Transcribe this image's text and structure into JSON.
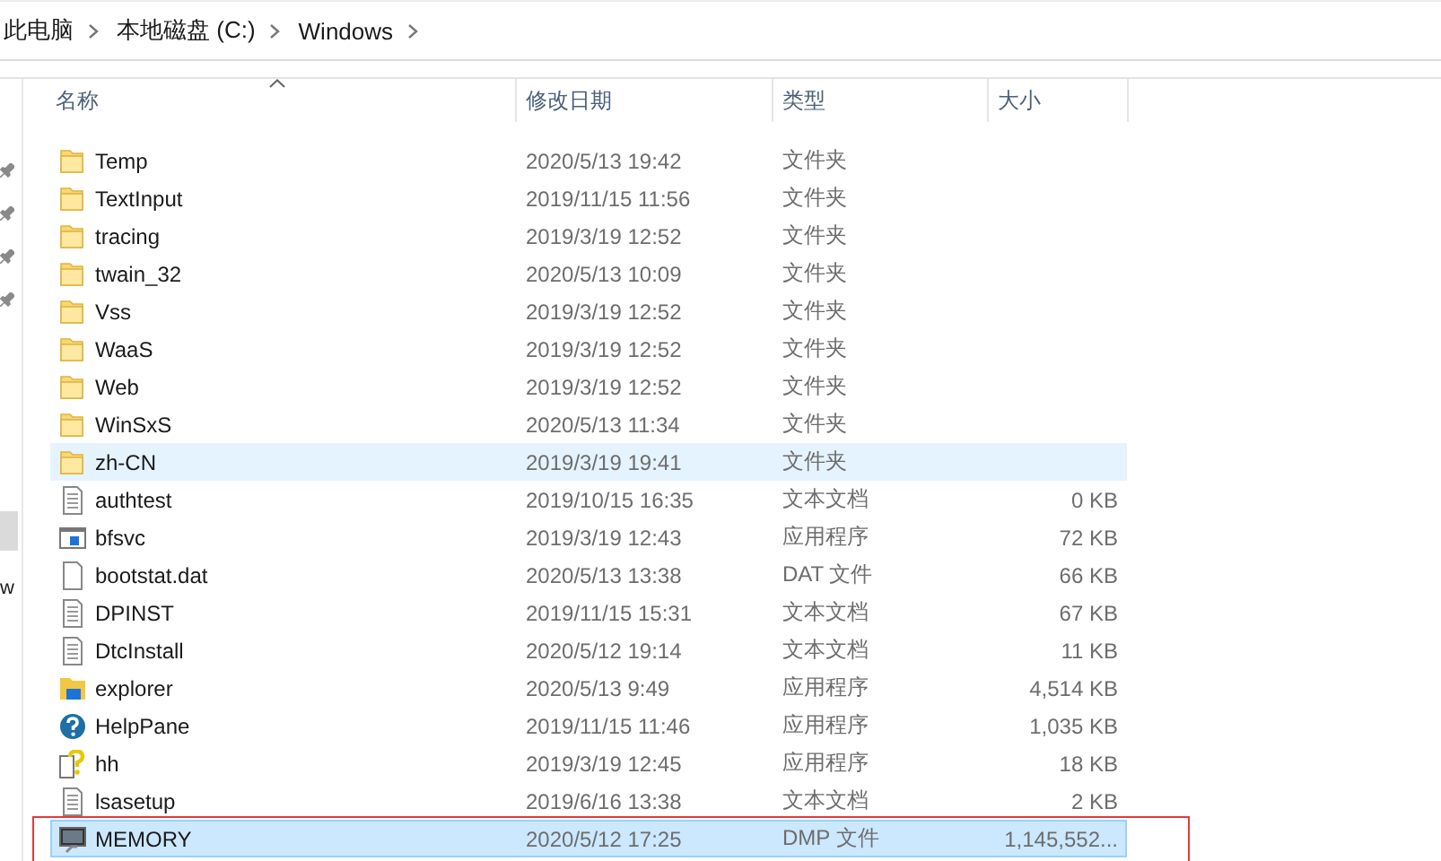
{
  "breadcrumb": [
    "此电脑",
    "本地磁盘 (C:)",
    "Windows"
  ],
  "nav_pane": {
    "items": [
      {
        "kind": "pin"
      },
      {
        "kind": "pin"
      },
      {
        "kind": "pin"
      },
      {
        "kind": "pin"
      },
      {
        "kind": "gap"
      },
      {
        "kind": "selected"
      },
      {
        "kind": "text",
        "label": "w"
      }
    ]
  },
  "table": {
    "columns": [
      {
        "label": "名称",
        "sorted": true
      },
      {
        "label": "修改日期",
        "sorted": false
      },
      {
        "label": "类型",
        "sorted": false
      },
      {
        "label": "大小",
        "sorted": false
      }
    ],
    "rows": [
      {
        "kind": "folder",
        "name": "Temp",
        "date": "2020/5/13 19:42",
        "type": "文件夹",
        "size": "",
        "highlighted": false,
        "selected": false
      },
      {
        "kind": "folder",
        "name": "TextInput",
        "date": "2019/11/15 11:56",
        "type": "文件夹",
        "size": "",
        "highlighted": false,
        "selected": false
      },
      {
        "kind": "folder",
        "name": "tracing",
        "date": "2019/3/19 12:52",
        "type": "文件夹",
        "size": "",
        "highlighted": false,
        "selected": false
      },
      {
        "kind": "folder",
        "name": "twain_32",
        "date": "2020/5/13 10:09",
        "type": "文件夹",
        "size": "",
        "highlighted": false,
        "selected": false
      },
      {
        "kind": "folder",
        "name": "Vss",
        "date": "2019/3/19 12:52",
        "type": "文件夹",
        "size": "",
        "highlighted": false,
        "selected": false
      },
      {
        "kind": "folder",
        "name": "WaaS",
        "date": "2019/3/19 12:52",
        "type": "文件夹",
        "size": "",
        "highlighted": false,
        "selected": false
      },
      {
        "kind": "folder",
        "name": "Web",
        "date": "2019/3/19 12:52",
        "type": "文件夹",
        "size": "",
        "highlighted": false,
        "selected": false
      },
      {
        "kind": "folder",
        "name": "WinSxS",
        "date": "2020/5/13 11:34",
        "type": "文件夹",
        "size": "",
        "highlighted": false,
        "selected": false
      },
      {
        "kind": "folder",
        "name": "zh-CN",
        "date": "2019/3/19 19:41",
        "type": "文件夹",
        "size": "",
        "highlighted": true,
        "selected": false
      },
      {
        "kind": "text",
        "name": "authtest",
        "date": "2019/10/15 16:35",
        "type": "文本文档",
        "size": "0 KB",
        "highlighted": false,
        "selected": false
      },
      {
        "kind": "app",
        "name": "bfsvc",
        "date": "2019/3/19 12:43",
        "type": "应用程序",
        "size": "72 KB",
        "highlighted": false,
        "selected": false
      },
      {
        "kind": "blank",
        "name": "bootstat.dat",
        "date": "2020/5/13 13:38",
        "type": "DAT 文件",
        "size": "66 KB",
        "highlighted": false,
        "selected": false
      },
      {
        "kind": "text",
        "name": "DPINST",
        "date": "2019/11/15 15:31",
        "type": "文本文档",
        "size": "67 KB",
        "highlighted": false,
        "selected": false
      },
      {
        "kind": "text",
        "name": "DtcInstall",
        "date": "2020/5/12 19:14",
        "type": "文本文档",
        "size": "11 KB",
        "highlighted": false,
        "selected": false
      },
      {
        "kind": "explorer",
        "name": "explorer",
        "date": "2020/5/13 9:49",
        "type": "应用程序",
        "size": "4,514 KB",
        "highlighted": false,
        "selected": false
      },
      {
        "kind": "help",
        "name": "HelpPane",
        "date": "2019/11/15 11:46",
        "type": "应用程序",
        "size": "1,035 KB",
        "highlighted": false,
        "selected": false
      },
      {
        "kind": "hh",
        "name": "hh",
        "date": "2019/3/19 12:45",
        "type": "应用程序",
        "size": "18 KB",
        "highlighted": false,
        "selected": false
      },
      {
        "kind": "text",
        "name": "lsasetup",
        "date": "2019/6/16 13:38",
        "type": "文本文档",
        "size": "2 KB",
        "highlighted": false,
        "selected": false
      },
      {
        "kind": "dump",
        "name": "MEMORY",
        "date": "2020/5/12 17:25",
        "type": "DMP 文件",
        "size": "1,145,552...",
        "highlighted": false,
        "selected": true
      }
    ]
  }
}
